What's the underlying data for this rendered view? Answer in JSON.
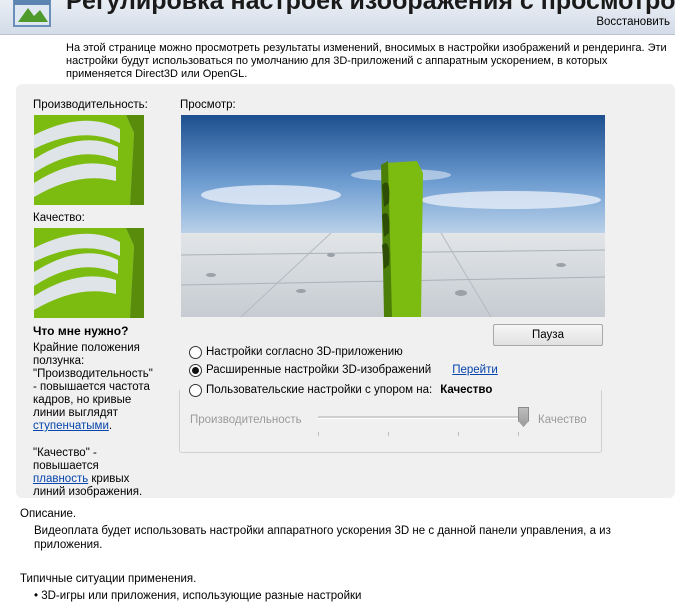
{
  "header": {
    "title": "Регулировка настроек изображения с просмотром",
    "restore_label": "Восстановить"
  },
  "intro": "На этой странице можно просмотреть результаты изменений, вносимых в настройки изображений и рендеринга. Эти настройки будут использоваться по умолчанию для 3D-приложений с аппаратным ускорением, в которых применяется Direct3D или OpenGL.",
  "side": {
    "performance_label": "Производительность:",
    "quality_label": "Качество:",
    "help_title": "Что мне нужно?",
    "help_para1_before": "Крайние положения ползунка: \"Производительность\" - повышается частота кадров, но кривые линии выглядят ",
    "help_para1_link": "ступенчатыми",
    "help_para1_after": ".",
    "help_para2_before": "\"Качество\" - повышается ",
    "help_para2_link": "плавность",
    "help_para2_after": " кривых линий изображения."
  },
  "preview": {
    "label": "Просмотр:",
    "pause_label": "Пауза"
  },
  "options": {
    "app_controlled": "Настройки согласно 3D-приложению",
    "advanced": "Расширенные настройки 3D-изображений",
    "advanced_link": "Перейти",
    "custom": "Пользовательские настройки с упором на:",
    "custom_value": "Качество",
    "selected": "advanced"
  },
  "slider": {
    "left_label": "Производительность",
    "right_label": "Качество",
    "value_percent": 100
  },
  "description": {
    "title": "Описание.",
    "text": "Видеоплата будет использовать настройки аппаратного ускорения 3D не с данной панели управления, а из приложения."
  },
  "usage": {
    "title": "Типичные ситуации применения.",
    "items": [
      "3D-игры или приложения, использующие разные настройки"
    ]
  },
  "colors": {
    "accent_green": "#7cbb10",
    "link_blue": "#0645ad",
    "panel_bg": "#f0f0f0"
  }
}
